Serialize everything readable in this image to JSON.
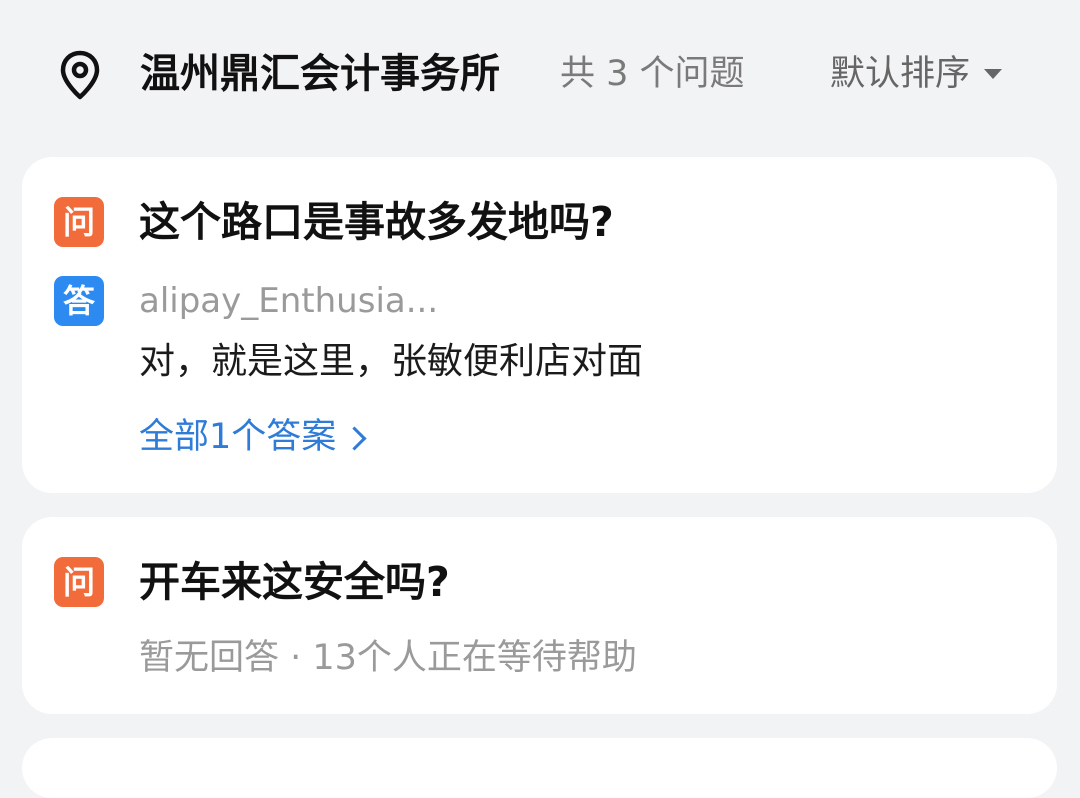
{
  "header": {
    "place_name": "温州鼎汇会计事务所",
    "question_count": "共 3 个问题",
    "sort_label": "默认排序",
    "location_icon": "map-pin-icon",
    "sort_icon": "caret-down-icon"
  },
  "badges": {
    "question": "问",
    "answer": "答",
    "question_color": "#f26b3a",
    "answer_color": "#2c8af0"
  },
  "questions": [
    {
      "title": "这个路口是事故多发地吗?",
      "answer_user": "alipay_Enthusia...",
      "answer_text": "对，就是这里，张敏便利店对面",
      "all_answers_label": "全部1个答案"
    },
    {
      "title": "开车来这安全吗?",
      "status_text": "暂无回答 · 13个人正在等待帮助"
    }
  ],
  "colors": {
    "background": "#f2f3f5",
    "link": "#2f7bd8"
  }
}
